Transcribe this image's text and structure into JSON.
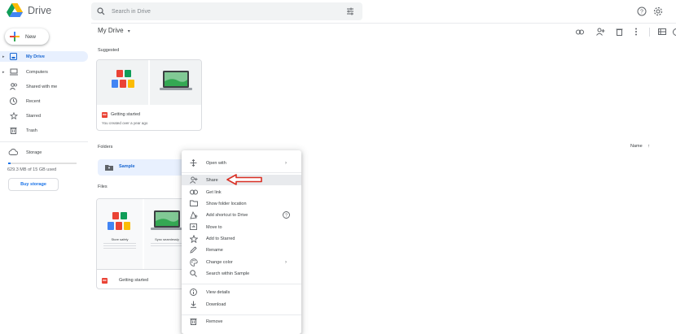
{
  "app": {
    "title": "Drive"
  },
  "search": {
    "placeholder": "Search in Drive"
  },
  "sidebar": {
    "new_label": "New",
    "items": [
      {
        "label": "My Drive",
        "icon": "my-drive-icon",
        "active": true
      },
      {
        "label": "Computers",
        "icon": "computer-icon"
      },
      {
        "label": "Shared with me",
        "icon": "people-icon"
      },
      {
        "label": "Recent",
        "icon": "clock-icon"
      },
      {
        "label": "Starred",
        "icon": "star-icon"
      },
      {
        "label": "Trash",
        "icon": "trash-icon"
      }
    ],
    "storage_label": "Storage",
    "storage_used": "629.3 MB of 15 GB used",
    "storage_fraction": 0.04,
    "buy_storage": "Buy storage"
  },
  "main": {
    "title": "My Drive",
    "suggested_label": "Suggested",
    "suggested_card": {
      "title": "Getting started",
      "subtitle": "You created over a year ago"
    },
    "folders_label": "Folders",
    "sort_label": "Name",
    "folder": {
      "name": "Sample"
    },
    "files_label": "Files",
    "file_card": {
      "title": "Getting started",
      "thumb_left_title": "Store safely",
      "thumb_right_title": "Sync seamlessly"
    }
  },
  "context_menu": {
    "items": [
      {
        "label": "Open with",
        "icon": "move-icon",
        "trail": "›"
      },
      {
        "label": "Share",
        "icon": "share-person-icon",
        "highlighted": true
      },
      {
        "label": "Get link",
        "icon": "link-icon"
      },
      {
        "label": "Show folder location",
        "icon": "folder-icon"
      },
      {
        "label": "Add shortcut to Drive",
        "icon": "shortcut-icon",
        "trail": "?"
      },
      {
        "label": "Move to",
        "icon": "move-to-icon"
      },
      {
        "label": "Add to Starred",
        "icon": "star-icon"
      },
      {
        "label": "Rename",
        "icon": "pencil-icon"
      },
      {
        "label": "Change color",
        "icon": "palette-icon",
        "trail": "›"
      },
      {
        "label": "Search within Sample",
        "icon": "search-icon"
      },
      {
        "label": "View details",
        "icon": "info-icon"
      },
      {
        "label": "Download",
        "icon": "download-icon"
      },
      {
        "label": "Remove",
        "icon": "trash-icon"
      }
    ]
  },
  "colors": {
    "accent": "#1a73e8",
    "active_bg": "#e8f0fe",
    "annotation_arrow": "#d93025"
  }
}
